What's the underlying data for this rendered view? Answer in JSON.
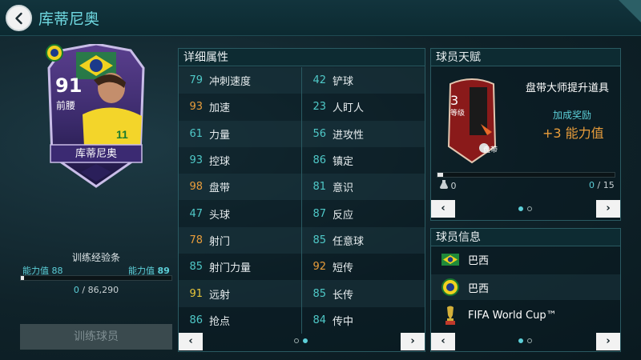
{
  "header": {
    "title": "库蒂尼奥"
  },
  "player_card": {
    "rating": "91",
    "position": "前腰",
    "name": "库蒂尼奥",
    "flag_icon": "brazil-flag-icon",
    "team_badge_icon": "brazil-badge-icon"
  },
  "training": {
    "title": "训练经验条",
    "current_label": "能力值",
    "current_value": "88",
    "next_label": "能力值",
    "next_value": "89",
    "xp_current": "0",
    "xp_total": "86,290",
    "progress": 0.02,
    "button_label": "训练球员"
  },
  "attributes": {
    "title": "详细属性",
    "rows": [
      [
        {
          "value": "79",
          "name": "冲刺速度",
          "color": "teal"
        },
        {
          "value": "42",
          "name": "铲球",
          "color": "teal"
        }
      ],
      [
        {
          "value": "93",
          "name": "加速",
          "color": "orange"
        },
        {
          "value": "23",
          "name": "人盯人",
          "color": "teal"
        }
      ],
      [
        {
          "value": "61",
          "name": "力量",
          "color": "teal"
        },
        {
          "value": "56",
          "name": "进攻性",
          "color": "teal"
        }
      ],
      [
        {
          "value": "93",
          "name": "控球",
          "color": "teal"
        },
        {
          "value": "86",
          "name": "镇定",
          "color": "teal"
        }
      ],
      [
        {
          "value": "98",
          "name": "盘带",
          "color": "orange"
        },
        {
          "value": "81",
          "name": "意识",
          "color": "teal"
        }
      ],
      [
        {
          "value": "47",
          "name": "头球",
          "color": "teal"
        },
        {
          "value": "87",
          "name": "反应",
          "color": "teal"
        }
      ],
      [
        {
          "value": "78",
          "name": "射门",
          "color": "orange"
        },
        {
          "value": "85",
          "name": "任意球",
          "color": "teal"
        }
      ],
      [
        {
          "value": "85",
          "name": "射门力量",
          "color": "teal"
        },
        {
          "value": "92",
          "name": "短传",
          "color": "orange"
        }
      ],
      [
        {
          "value": "91",
          "name": "远射",
          "color": "yellow"
        },
        {
          "value": "85",
          "name": "长传",
          "color": "teal"
        }
      ],
      [
        {
          "value": "86",
          "name": "抢点",
          "color": "teal"
        },
        {
          "value": "84",
          "name": "传中",
          "color": "teal"
        }
      ]
    ],
    "prev_label": "‹",
    "next_label": "›",
    "page_dots": [
      false,
      true
    ]
  },
  "talent": {
    "title": "球员天赋",
    "level_number": "3",
    "level_label": "等级",
    "skill_label": "盘带",
    "item_name": "盘带大师提升道具",
    "reward_label": "加成奖励",
    "reward_value": "+3 能力值",
    "owned_count": "0",
    "progress_current": "0",
    "progress_total": "15",
    "prev_label": "‹",
    "next_label": "›",
    "page_dots": [
      true,
      false
    ]
  },
  "player_info": {
    "title": "球员信息",
    "rows": [
      {
        "icon": "brazil-flag-icon",
        "text": "巴西"
      },
      {
        "icon": "brazil-badge-icon",
        "text": "巴西"
      },
      {
        "icon": "world-cup-icon",
        "text": "FIFA World Cup™"
      }
    ],
    "prev_label": "‹",
    "next_label": "›",
    "page_dots": [
      true,
      false
    ]
  },
  "colors": {
    "accent": "#5ccfd8",
    "orange": "#e99d3b",
    "yellow": "#e6c53a",
    "teal": "#4fc9c8"
  }
}
